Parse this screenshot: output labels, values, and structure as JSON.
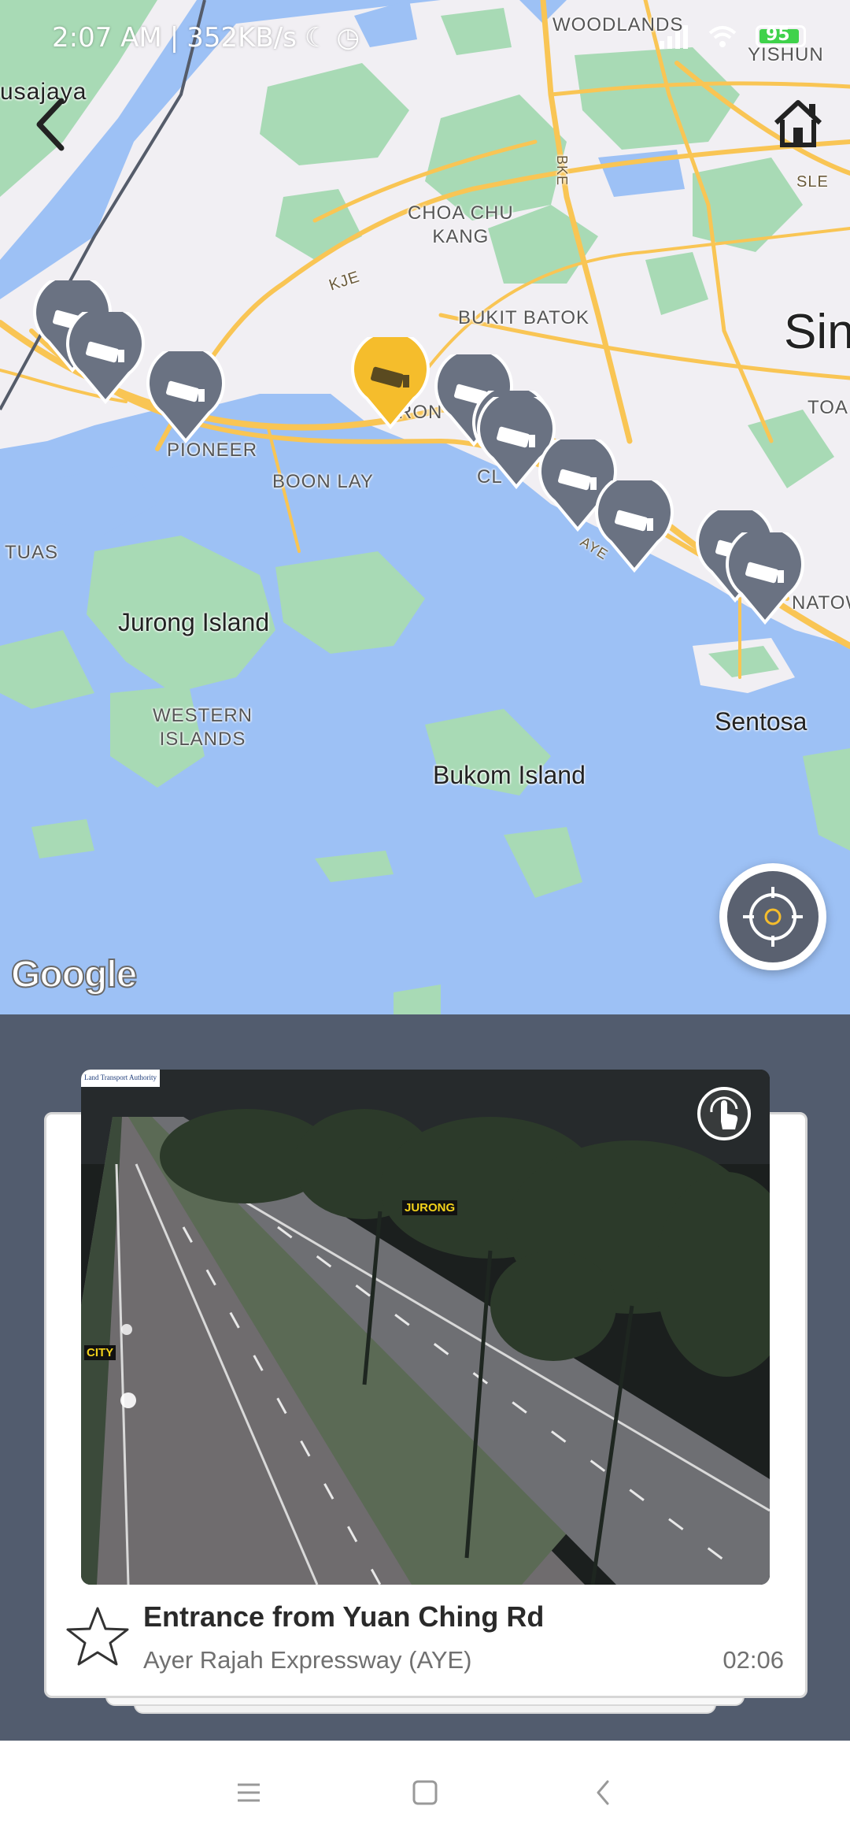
{
  "status_bar": {
    "time": "2:07 AM",
    "network_speed": "352KB/s",
    "battery_level": "95",
    "icons": [
      "moon-icon",
      "alarm-icon",
      "silent-icon",
      "signal-icon",
      "wifi-icon",
      "battery-icon"
    ]
  },
  "map": {
    "labels": {
      "woodlands": "WOODLANDS",
      "yishun": "YISHUN",
      "kusajaya": "usajaya",
      "choa_chu_kang": "CHOA CHU\nKANG",
      "bke": "BKE",
      "sle": "SLE",
      "kje": "KJE",
      "bukit_batok": "BUKIT BATOK",
      "sin": "Sin",
      "toa": "TOA",
      "pioneer": "PIONEER",
      "boon_lay": "BOON LAY",
      "jurong": "RON",
      "clementi": "CL",
      "aye": "AYE",
      "tuas": "TUAS",
      "jurong_island": "Jurong Island",
      "western_islands": "WESTERN\nISLANDS",
      "bukom_island": "Bukom Island",
      "sentosa": "Sentosa",
      "tanjong": "NATOW"
    },
    "attribution": "Google",
    "colors": {
      "sea": "#9dc1f5",
      "land": "#f1eff3",
      "green": "#a8dab5",
      "road": "#f9c554",
      "pin": "#6a7282",
      "pin_selected": "#f5bd2c"
    }
  },
  "camera": {
    "title": "Entrance from Yuan Ching Rd",
    "expressway": "Ayer Rajah Expressway (AYE)",
    "time": "02:06",
    "image_tags": {
      "jurong": "JURONG",
      "city": "CITY"
    },
    "watermark": "Land Transport Authority"
  },
  "nav": {
    "icons": [
      "menu-icon",
      "home-square-icon",
      "back-triangle-icon"
    ]
  }
}
